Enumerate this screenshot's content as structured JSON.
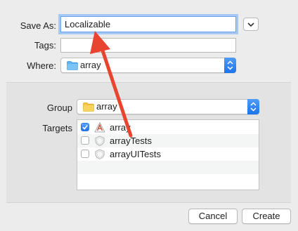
{
  "dialog": {
    "save_as_label": "Save As:",
    "save_as_value": "Localizable",
    "tags_label": "Tags:",
    "tags_value": "",
    "where_label": "Where:",
    "where_value": "array",
    "group_label": "Group",
    "group_value": "array",
    "targets_label": "Targets",
    "targets": [
      {
        "label": "array",
        "checked": true,
        "icon": "app-target-icon"
      },
      {
        "label": "arrayTests",
        "checked": false,
        "icon": "test-target-icon"
      },
      {
        "label": "arrayUITests",
        "checked": false,
        "icon": "test-target-icon"
      }
    ],
    "cancel_label": "Cancel",
    "create_label": "Create"
  },
  "colors": {
    "accent": "#1c73ea",
    "annotation_arrow": "#e8442f",
    "folder_blue": "#5fb4f0",
    "folder_yellow": "#f5c542"
  }
}
